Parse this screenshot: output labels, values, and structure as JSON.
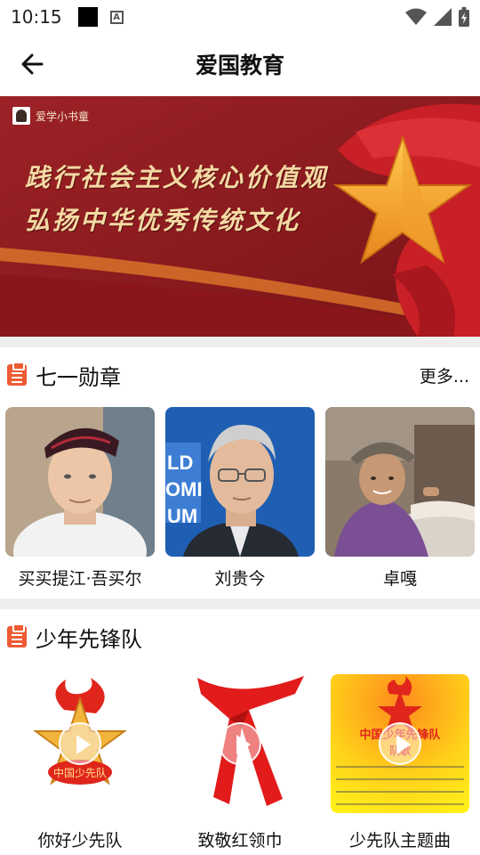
{
  "status_bar": {
    "time": "10:15",
    "a_badge": "A"
  },
  "header": {
    "title": "爱国教育",
    "back_icon": "arrow-left-icon"
  },
  "banner": {
    "logo_text": "爱学小书童",
    "line1": "践行社会主义核心价值观",
    "line2": "弘扬中华优秀传统文化",
    "colors": {
      "background": "#8e1b1e",
      "text": "#f3d9a3",
      "star": "#f5a623"
    }
  },
  "medal_section": {
    "title": "七一勋章",
    "more": "更多...",
    "icon": "clipboard-icon",
    "items": [
      {
        "name": "买买提江·吾买尔"
      },
      {
        "name": "刘贵今"
      },
      {
        "name": "卓嘎"
      }
    ]
  },
  "pioneer_section": {
    "title": "少年先锋队",
    "icon": "clipboard-icon",
    "videos": [
      {
        "title": "你好少先队",
        "thumb_text": "中国少先队"
      },
      {
        "title": "致敬红领巾"
      },
      {
        "title": "少先队主题曲",
        "thumb_text_1": "中国少年先锋队",
        "thumb_text_2": "队歌"
      }
    ]
  }
}
